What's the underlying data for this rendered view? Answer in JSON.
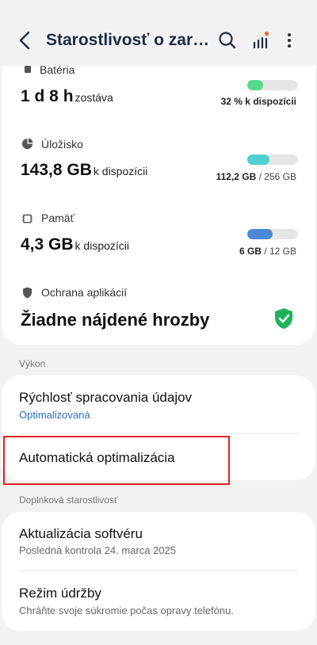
{
  "header": {
    "title": "Starostlivosť o zariadenie",
    "icons": {
      "back": "back-arrow-icon",
      "search": "search-icon",
      "stats": "stats-bars-icon",
      "more": "more-vertical-icon"
    }
  },
  "battery": {
    "label": "Batéria",
    "value": "1 d 8 h",
    "value_suffix": "zostáva",
    "bar_text": "32 % k dispozícii",
    "bar_fraction": 0.32,
    "bar_color": "#57d98c",
    "icon": "battery-icon"
  },
  "storage": {
    "label": "Úložisko",
    "value": "143,8 GB",
    "value_suffix": "k dispozícii",
    "used": "112,2 GB",
    "separator": " / ",
    "total": "256 GB",
    "bar_fraction": 0.44,
    "bar_color": "#4fcfcf",
    "icon": "pie-chart-icon"
  },
  "memory": {
    "label": "Pamäť",
    "value": "4,3 GB",
    "value_suffix": "k dispozícii",
    "used": "6 GB",
    "separator": " / ",
    "total": "12 GB",
    "bar_fraction": 0.5,
    "bar_color": "#4b89d6",
    "icon": "memory-chip-icon"
  },
  "protection": {
    "label": "Ochrana aplikácií",
    "status": "Žiadne nájdené hrozby",
    "icon": "shield-icon",
    "status_icon": "shield-check-icon",
    "status_color": "#1fb25a"
  },
  "performance": {
    "section_label": "Výkon",
    "items": [
      {
        "title": "Rýchlosť spracovania údajov",
        "subtitle": "Optimalizovaná"
      },
      {
        "title": "Automatická optimalizácia"
      }
    ]
  },
  "care": {
    "section_label": "Doplnková starostlivosť",
    "items": [
      {
        "title": "Aktualizácia softvéru",
        "subtitle": "Posledná kontrola 24. marca 2025"
      },
      {
        "title": "Režim údržby",
        "subtitle": "Chráňte svoje súkromie počas opravy telefónu."
      }
    ]
  },
  "colors": {
    "accent_link": "#2a6fc9",
    "highlight": "#e02020",
    "header_text": "#1f2b44",
    "notification_dot": "#f06a2a"
  }
}
